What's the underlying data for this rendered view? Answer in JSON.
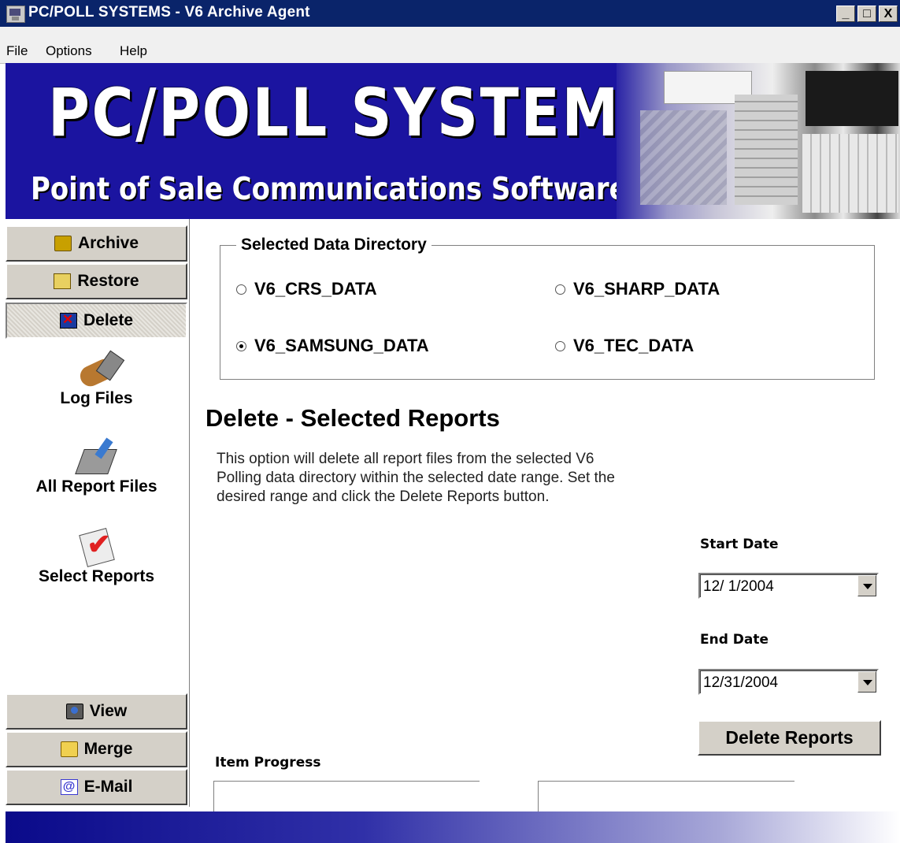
{
  "window": {
    "title": "PC/POLL SYSTEMS - V6 Archive Agent",
    "controls": [
      "_",
      "□",
      "X"
    ]
  },
  "menu": {
    "items": [
      "File",
      "Options",
      "Help"
    ]
  },
  "banner": {
    "title": "PC/POLL SYSTEMS",
    "subtitle": "Point of Sale Communications Software"
  },
  "nav": {
    "top_buttons": [
      {
        "label": "Archive",
        "icon": "archive-icon"
      },
      {
        "label": "Restore",
        "icon": "restore-icon"
      },
      {
        "label": "Delete",
        "icon": "delete-icon",
        "active": true
      }
    ],
    "sub_items": [
      {
        "label": "Log Files",
        "icon": "log-icon"
      },
      {
        "label": "All Report Files",
        "icon": "all-reports-icon"
      },
      {
        "label": "Select Reports",
        "icon": "select-reports-icon"
      }
    ],
    "bottom_buttons": [
      {
        "label": "View",
        "icon": "view-icon"
      },
      {
        "label": "Merge",
        "icon": "merge-icon"
      },
      {
        "label": "E-Mail",
        "icon": "email-icon"
      }
    ]
  },
  "data_directory": {
    "legend": "Selected Data Directory",
    "options": [
      {
        "label": "V6_CRS_DATA",
        "selected": false
      },
      {
        "label": "V6_SHARP_DATA",
        "selected": false
      },
      {
        "label": "V6_SAMSUNG_DATA",
        "selected": true
      },
      {
        "label": "V6_TEC_DATA",
        "selected": false
      }
    ]
  },
  "main": {
    "heading": "Delete - Selected Reports",
    "description": "This option will delete all report files from the selected V6 Polling data directory within the selected date range. Set the desired range and click the Delete Reports button.",
    "start_date_label": "Start Date",
    "start_date": "12/ 1/2004",
    "end_date_label": "End Date",
    "end_date": "12/31/2004",
    "delete_button": "Delete Reports",
    "progress_label": "Item Progress"
  },
  "colors": {
    "titlebar": "#0a246a",
    "banner": "#1b14a0",
    "button_face": "#d4d0c8"
  }
}
